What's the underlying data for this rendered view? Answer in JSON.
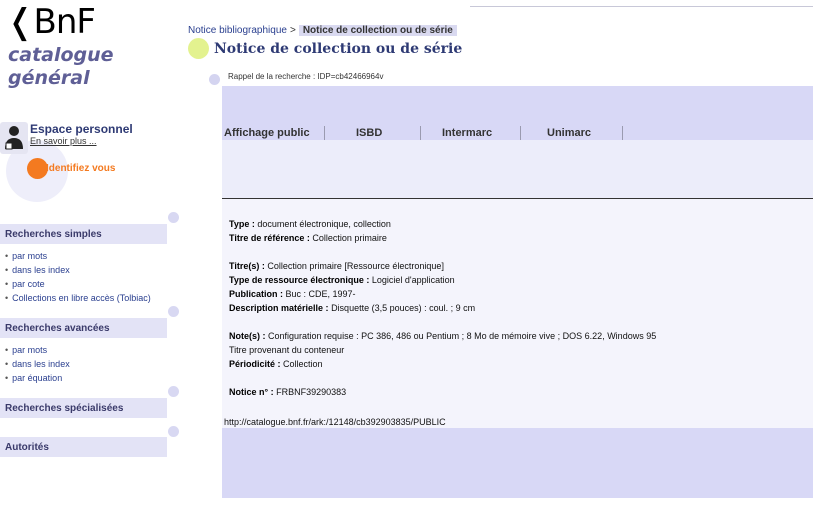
{
  "logo": {
    "brand": "❬BnF",
    "line1": "catalogue",
    "line2": "général"
  },
  "breadcrumb": {
    "parent": "Notice bibliographique",
    "separator": ">",
    "current": "Notice de collection ou de série"
  },
  "page_title": "Notice de collection ou de série",
  "search_recall": "Rappel de la recherche : IDP=cb42466964v",
  "tabs": [
    "Affichage public",
    "ISBD",
    "Intermarc",
    "Unimarc"
  ],
  "record": {
    "type_label": "Type :",
    "type_value": "document électronique, collection",
    "titre_ref_label": "Titre de référence :",
    "titre_ref_value": "Collection primaire",
    "titre_label": "Titre(s) :",
    "titre_value": "Collection primaire [Ressource électronique]",
    "type_res_label": "Type de ressource électronique :",
    "type_res_value": "Logiciel d'application",
    "publication_label": "Publication :",
    "publication_value": "Buc : CDE, 1997-",
    "description_label": "Description matérielle :",
    "description_value": "Disquette (3,5 pouces) : coul. ; 9 cm",
    "notes_label": "Note(s) :",
    "notes_value": "Configuration requise : PC 386, 486 ou Pentium ; 8 Mo de mémoire vive ; DOS 6.22, Windows 95",
    "notes_line2": "Titre provenant du conteneur",
    "periodicite_label": "Périodicité :",
    "periodicite_value": "Collection",
    "notice_label": "Notice n° :",
    "notice_value": "FRBNF39290383",
    "permalink": "http://catalogue.bnf.fr/ark:/12148/cb392903835/PUBLIC"
  },
  "user": {
    "espace": "Espace personnel",
    "en_savoir": "En savoir plus ...",
    "identify": "Identifiez vous"
  },
  "sidebar": {
    "simples": {
      "title": "Recherches simples",
      "items": [
        "par mots",
        "dans les index",
        "par cote",
        "Collections en libre accès (Tolbiac)"
      ]
    },
    "avancees": {
      "title": "Recherches avancées",
      "items": [
        "par mots",
        "dans les index",
        "par équation"
      ]
    },
    "specialisees": {
      "title": "Recherches spécialisées"
    },
    "autorites": {
      "title": "Autorités"
    }
  },
  "colors": {
    "accent_blue": "#2e3a74",
    "panel": "#d8d8f6",
    "orange": "#f47a20",
    "lime_dot": "#e3f28f"
  }
}
